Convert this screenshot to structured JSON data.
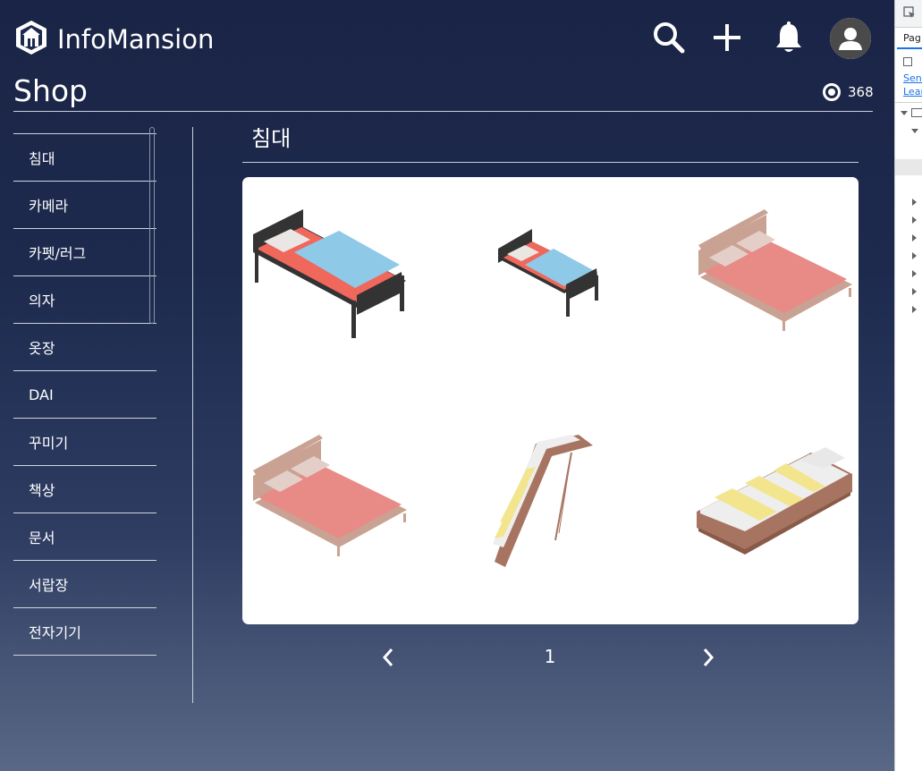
{
  "header": {
    "app_title": "InfoMansion",
    "icons": [
      "house-logo-icon",
      "search-icon",
      "plus-icon",
      "bell-icon",
      "user-avatar-icon"
    ]
  },
  "page": {
    "title": "Shop",
    "coin_count": "368"
  },
  "categories": [
    "침대",
    "카메라",
    "카펫/러그",
    "의자",
    "옷장",
    "DAI",
    "꾸미기",
    "책상",
    "문서",
    "서랍장",
    "전자기기"
  ],
  "section": {
    "title": "침대"
  },
  "products": [
    {
      "name": "black-frame-bed-large",
      "frame_color": "#2f2f2f",
      "sheet_color": "#f0675c",
      "blanket_color": "#8ec9e8"
    },
    {
      "name": "black-frame-bed-small",
      "frame_color": "#2f2f2f",
      "sheet_color": "#f0675c",
      "blanket_color": "#8ec9e8"
    },
    {
      "name": "pink-double-bed-1",
      "frame_color": "#c9a293",
      "sheet_color": "#e88a86",
      "blanket_color": "#e88a86"
    },
    {
      "name": "pink-double-bed-2",
      "frame_color": "#c9a293",
      "sheet_color": "#e88a86",
      "blanket_color": "#e88a86"
    },
    {
      "name": "tilted-striped-bed",
      "frame_color": "#a87462",
      "sheet_color": "#eeeeee",
      "blanket_color": "#f2e58e"
    },
    {
      "name": "striped-low-bed",
      "frame_color": "#a87462",
      "sheet_color": "#eeeeee",
      "blanket_color": "#f2e58e"
    }
  ],
  "pagination": {
    "current_page": "1",
    "prev_icon": "chevron-left-icon",
    "next_icon": "chevron-right-icon"
  },
  "devtools": {
    "tab_label": "Pag",
    "send_link": "Send",
    "learn_link": "Lear",
    "tree_rows": 7
  }
}
